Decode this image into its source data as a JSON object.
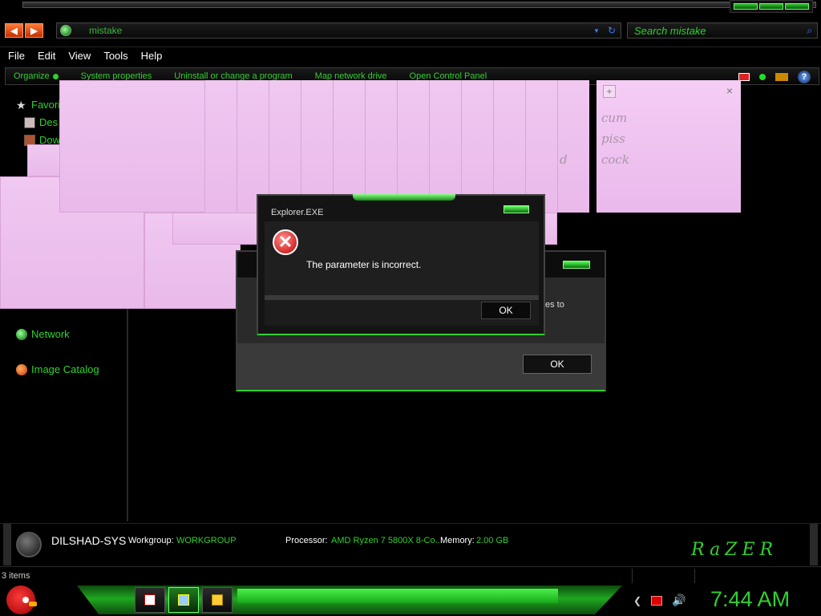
{
  "address": {
    "path": "mistake"
  },
  "search": {
    "placeholder": "Search mistake"
  },
  "menu": [
    "File",
    "Edit",
    "View",
    "Tools",
    "Help"
  ],
  "command_bar": {
    "organize": "Organize",
    "system_properties": "System properties",
    "uninstall": "Uninstall or change a program",
    "map_drive": "Map network drive",
    "control_panel": "Open Control Panel"
  },
  "sidebar": {
    "favorites": "Favori",
    "desktop": "Des",
    "downloads": "Dow",
    "network": "Network",
    "image_catalog": "Image Catalog"
  },
  "sticky_note": {
    "add": "+",
    "close": "×",
    "lines": [
      "cum",
      "piss",
      "cock"
    ],
    "partial_char": "d"
  },
  "bg_dialog": {
    "text_fragment": "es to",
    "ok_label": "OK"
  },
  "error_dialog": {
    "title": "Explorer.EXE",
    "message": "The parameter is incorrect.",
    "ok_label": "OK",
    "icon_glyph": "✕"
  },
  "details": {
    "computer_name": "DILSHAD-SYS",
    "workgroup_label": "Workgroup:",
    "workgroup_value": "WORKGROUP",
    "processor_label": "Processor:",
    "processor_value": "AMD Ryzen 7 5800X 8-Co...",
    "memory_label": "Memory:",
    "memory_value": "2.00 GB",
    "brand": "RaZER"
  },
  "status": {
    "items": "3 items"
  },
  "taskbar": {
    "clock": "7:44 AM"
  },
  "colors": {
    "accent": "#2fd12f",
    "note_pink": "#ecbdec",
    "error_red": "#c10000"
  }
}
